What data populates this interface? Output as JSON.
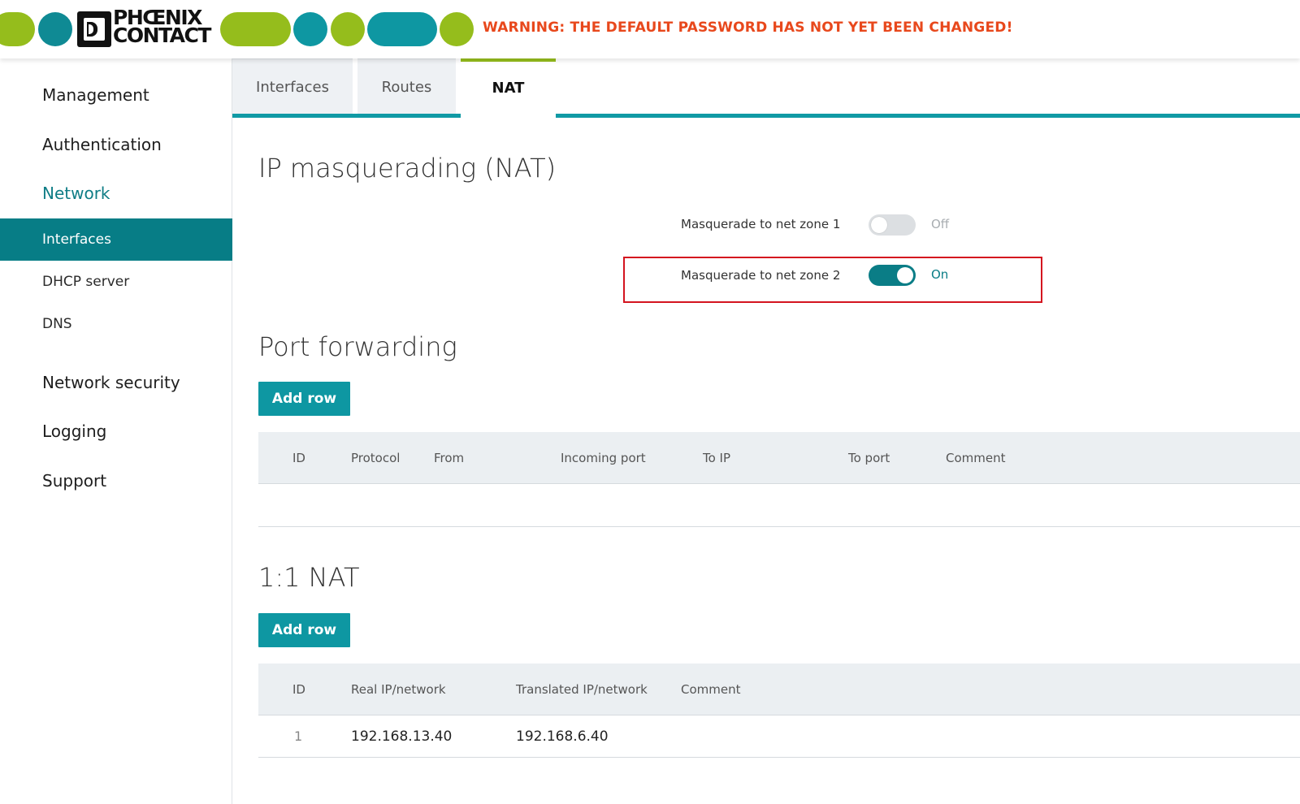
{
  "header": {
    "logo_line1": "PHŒNIX",
    "logo_line2": "CONTACT",
    "warning": "WARNING: THE DEFAULT PASSWORD HAS NOT YET BEEN CHANGED!",
    "colors": {
      "green": "#95bd1c",
      "teal": "#0e97a2",
      "warning": "#e8481c"
    }
  },
  "sidebar": {
    "items": [
      {
        "label": "Management"
      },
      {
        "label": "Authentication"
      },
      {
        "label": "Network",
        "active": true
      },
      {
        "label": "Interfaces",
        "active": true
      },
      {
        "label": "DHCP server"
      },
      {
        "label": "DNS"
      },
      {
        "label": "Network security"
      },
      {
        "label": "Logging"
      },
      {
        "label": "Support"
      }
    ]
  },
  "tabs": [
    {
      "label": "Interfaces"
    },
    {
      "label": "Routes"
    },
    {
      "label": "NAT",
      "active": true
    }
  ],
  "masquerading": {
    "title": "IP masquerading (NAT)",
    "zone1": {
      "label": "Masquerade to net zone 1",
      "state": "Off"
    },
    "zone2": {
      "label": "Masquerade to net zone 2",
      "state": "On"
    }
  },
  "port_forwarding": {
    "title": "Port forwarding",
    "add_label": "Add row",
    "columns": [
      "ID",
      "Protocol",
      "From",
      "Incoming port",
      "To IP",
      "To port",
      "Comment"
    ],
    "rows": []
  },
  "one_to_one_nat": {
    "title": "1:1 NAT",
    "add_label": "Add row",
    "columns": [
      "ID",
      "Real IP/network",
      "Translated IP/network",
      "Comment"
    ],
    "rows": [
      {
        "id": "1",
        "real": "192.168.13.40",
        "translated": "192.168.6.40",
        "comment": ""
      }
    ]
  }
}
